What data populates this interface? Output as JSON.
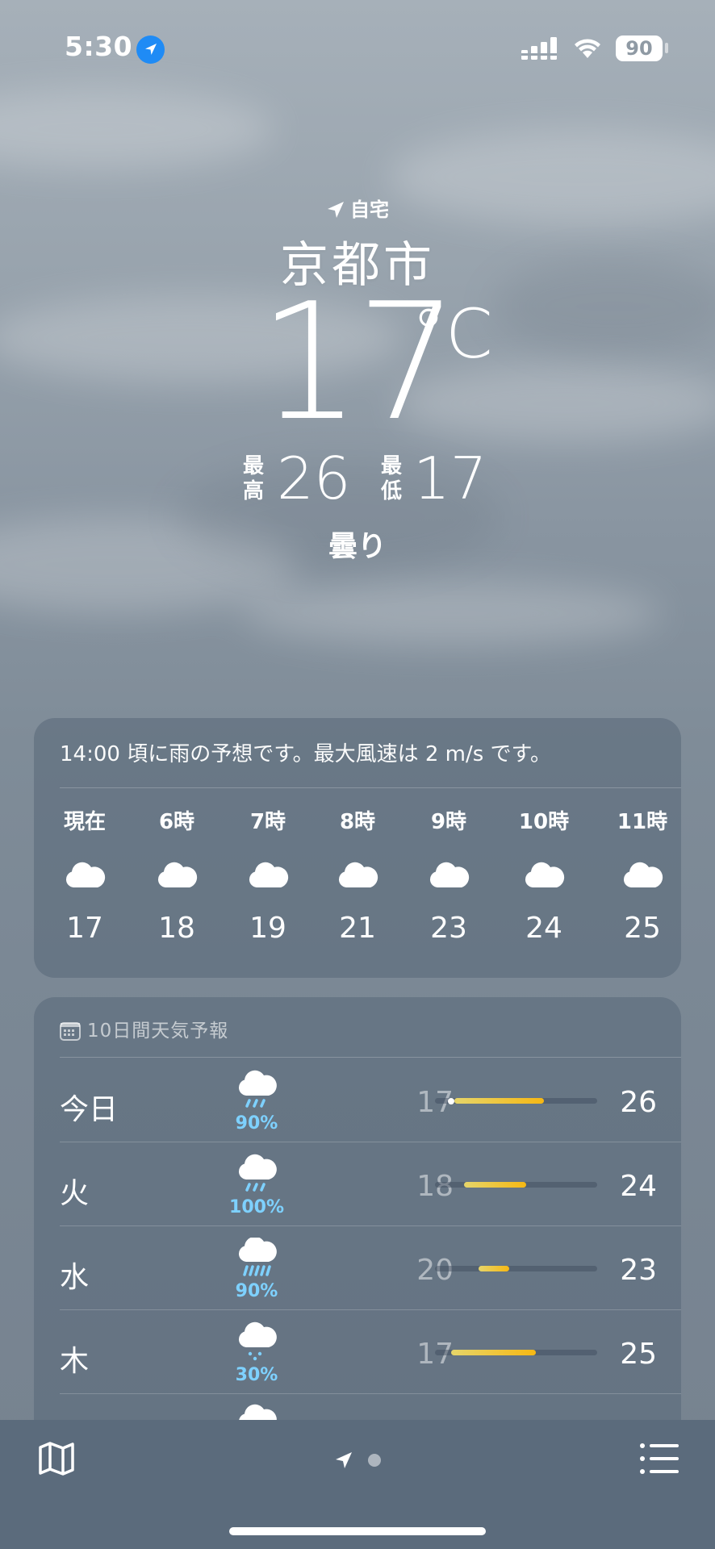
{
  "status_bar": {
    "time": "5:30",
    "battery": "90"
  },
  "header": {
    "location_tag": "自宅",
    "city": "京都市",
    "temperature": "17",
    "unit": "°C",
    "high_label": "最高",
    "high_value": "26",
    "low_label": "最低",
    "low_value": "17",
    "condition": "曇り"
  },
  "hourly": {
    "summary": "14:00 頃に雨の予想です。最大風速は 2 m/s です。",
    "items": [
      {
        "label": "現在",
        "icon": "cloud-icon",
        "temp": "17"
      },
      {
        "label": "6時",
        "icon": "cloud-icon",
        "temp": "18"
      },
      {
        "label": "7時",
        "icon": "cloud-icon",
        "temp": "19"
      },
      {
        "label": "8時",
        "icon": "cloud-icon",
        "temp": "21"
      },
      {
        "label": "9時",
        "icon": "cloud-icon",
        "temp": "23"
      },
      {
        "label": "10時",
        "icon": "cloud-icon",
        "temp": "24"
      },
      {
        "label": "11時",
        "icon": "cloud-icon",
        "temp": "25"
      }
    ]
  },
  "daily": {
    "header": "10日間天気予報",
    "range": [
      17,
      26
    ],
    "days": [
      {
        "day": "今日",
        "icon": "cloud-rain-icon",
        "precip": "90%",
        "low": "17",
        "high": "26",
        "bar_start": 0.12,
        "bar_end": 0.67,
        "current_pos": 0.1
      },
      {
        "day": "火",
        "icon": "cloud-rain-icon",
        "precip": "100%",
        "low": "18",
        "high": "24",
        "bar_start": 0.18,
        "bar_end": 0.56
      },
      {
        "day": "水",
        "icon": "cloud-heavy-rain-icon",
        "precip": "90%",
        "low": "20",
        "high": "23",
        "bar_start": 0.27,
        "bar_end": 0.46
      },
      {
        "day": "木",
        "icon": "cloud-drizzle-icon",
        "precip": "30%",
        "low": "17",
        "high": "25",
        "bar_start": 0.1,
        "bar_end": 0.62
      }
    ]
  },
  "colors": {
    "accent_blue": "#1f8bf5",
    "precip_blue": "#7ed1ff",
    "bar_yellow": "#f6b814",
    "bar_green_yellow": "#e6d56a"
  }
}
